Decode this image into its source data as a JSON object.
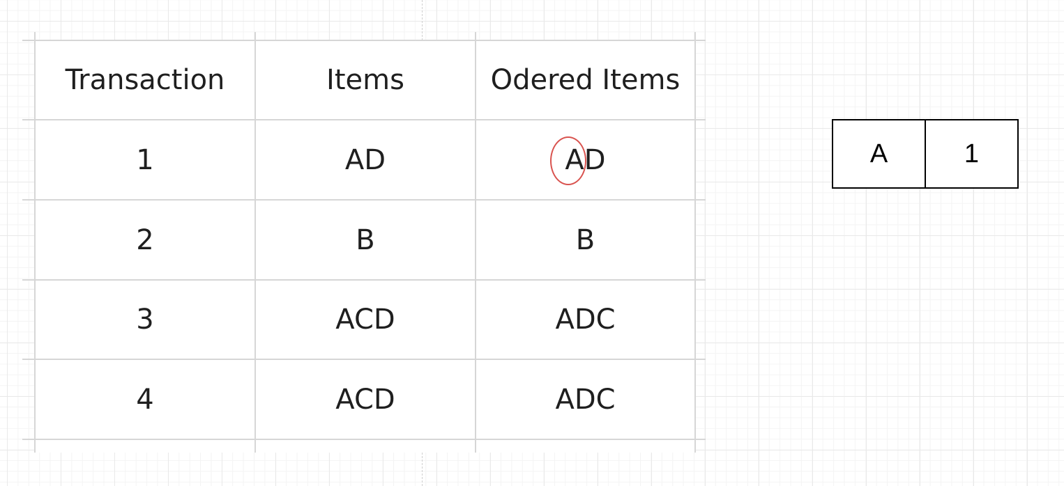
{
  "table": {
    "headers": [
      "Transaction",
      "Items",
      "Odered Items"
    ],
    "rows": [
      [
        "1",
        "AD",
        "AD"
      ],
      [
        "2",
        "B",
        "B"
      ],
      [
        "3",
        "ACD",
        "ADC"
      ],
      [
        "4",
        "ACD",
        "ADC"
      ]
    ]
  },
  "annotation": {
    "circled_item": "A",
    "circle_color": "#d9534f"
  },
  "result_box": {
    "item": "A",
    "count": "1"
  }
}
